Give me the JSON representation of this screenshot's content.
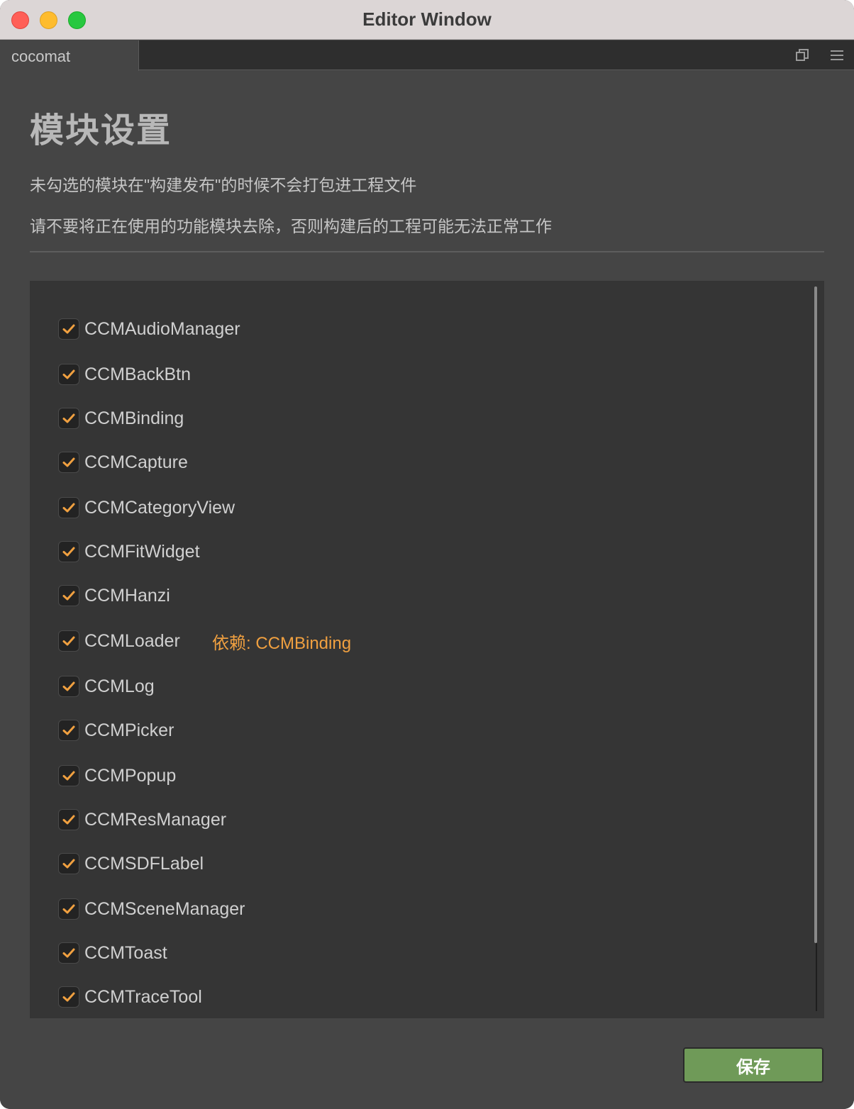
{
  "window": {
    "title": "Editor Window"
  },
  "tabbar": {
    "tab_label": "cocomat",
    "icons": [
      "popout-icon",
      "menu-icon"
    ]
  },
  "page": {
    "title": "模块设置",
    "desc1": "未勾选的模块在\"构建发布\"的时候不会打包进工程文件",
    "desc2": "请不要将正在使用的功能模块去除，否则构建后的工程可能无法正常工作"
  },
  "modules": [
    {
      "name": "CCMAudioManager",
      "checked": true,
      "dependency": ""
    },
    {
      "name": "CCMBackBtn",
      "checked": true,
      "dependency": ""
    },
    {
      "name": "CCMBinding",
      "checked": true,
      "dependency": ""
    },
    {
      "name": "CCMCapture",
      "checked": true,
      "dependency": ""
    },
    {
      "name": "CCMCategoryView",
      "checked": true,
      "dependency": ""
    },
    {
      "name": "CCMFitWidget",
      "checked": true,
      "dependency": ""
    },
    {
      "name": "CCMHanzi",
      "checked": true,
      "dependency": ""
    },
    {
      "name": "CCMLoader",
      "checked": true,
      "dependency": "依赖: CCMBinding"
    },
    {
      "name": "CCMLog",
      "checked": true,
      "dependency": ""
    },
    {
      "name": "CCMPicker",
      "checked": true,
      "dependency": ""
    },
    {
      "name": "CCMPopup",
      "checked": true,
      "dependency": ""
    },
    {
      "name": "CCMResManager",
      "checked": true,
      "dependency": ""
    },
    {
      "name": "CCMSDFLabel",
      "checked": true,
      "dependency": ""
    },
    {
      "name": "CCMSceneManager",
      "checked": true,
      "dependency": ""
    },
    {
      "name": "CCMToast",
      "checked": true,
      "dependency": ""
    },
    {
      "name": "CCMTraceTool",
      "checked": true,
      "dependency": ""
    }
  ],
  "footer": {
    "save_label": "保存"
  },
  "colors": {
    "accent_check": "#f0a040",
    "save_button": "#6f9a58",
    "panel_bg": "#353535",
    "window_bg": "#454545"
  }
}
